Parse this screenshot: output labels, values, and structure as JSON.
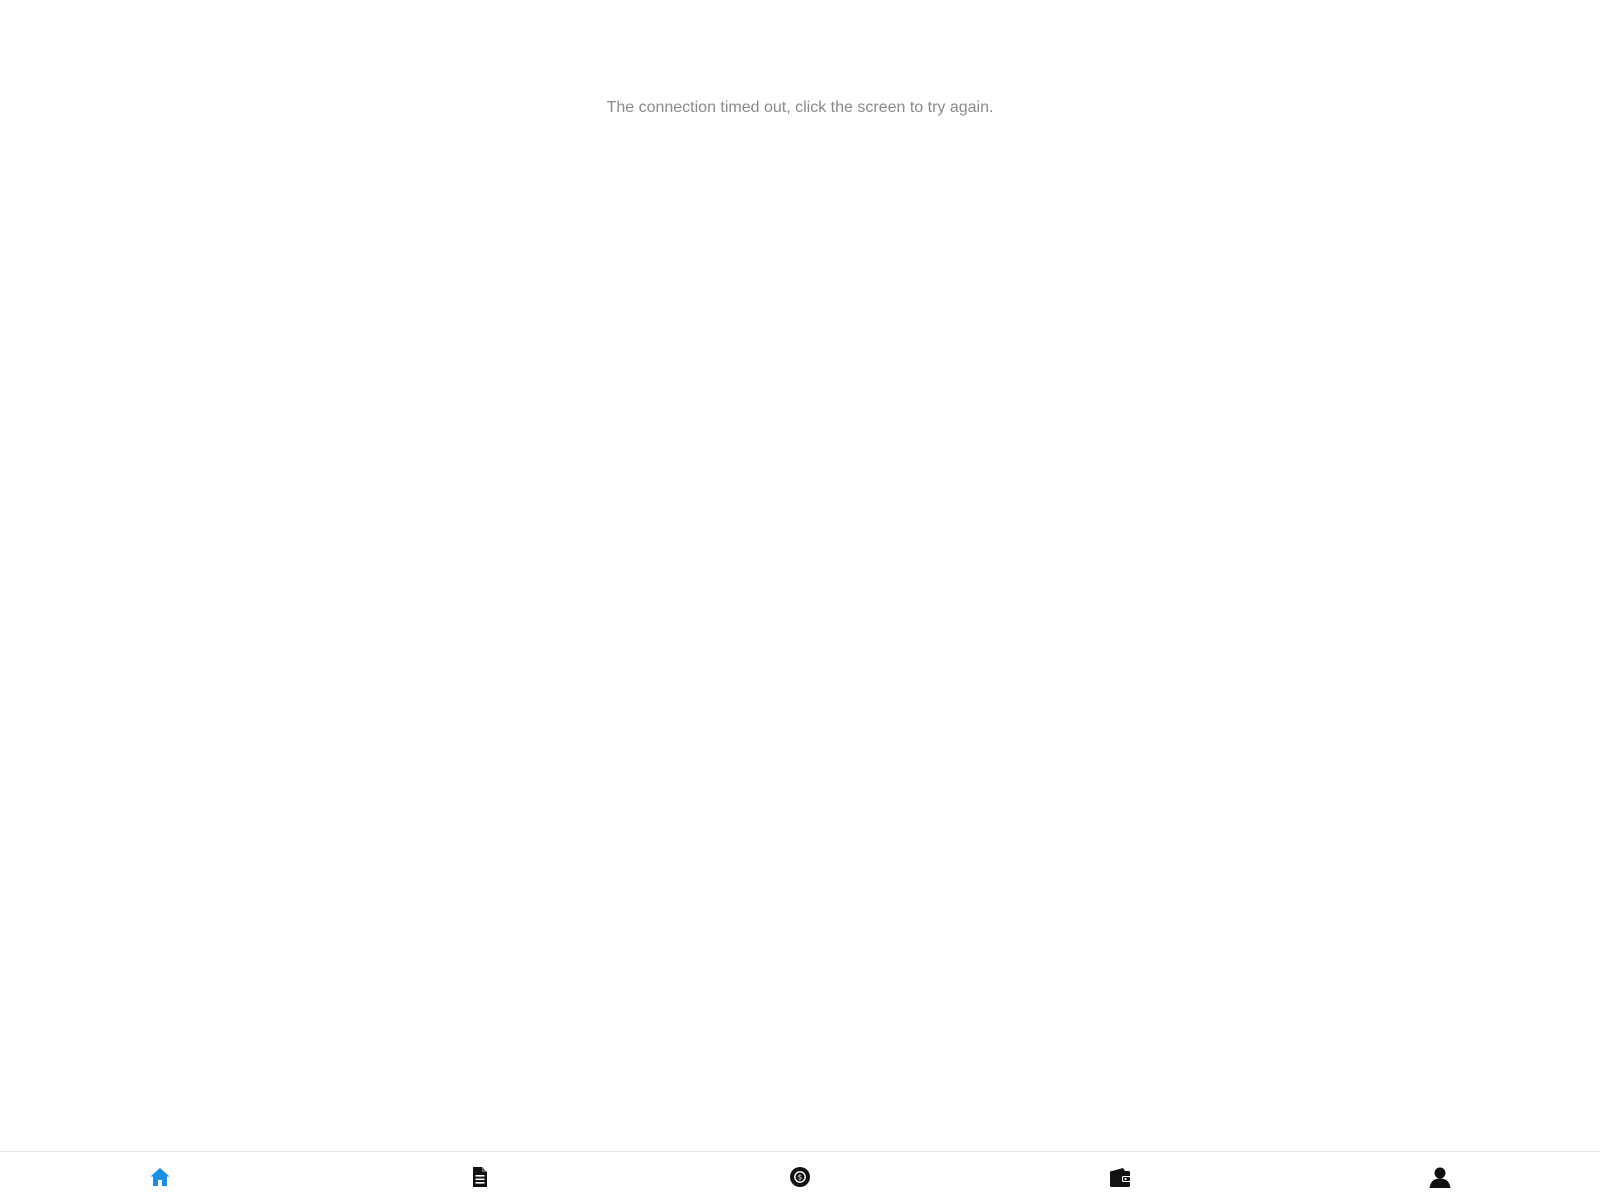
{
  "screen": {
    "message": "The connection timed out, click the screen to try again."
  },
  "tab_bar": {
    "items": [
      {
        "icon": "home-icon",
        "active": true
      },
      {
        "icon": "document-icon",
        "active": false
      },
      {
        "icon": "coin-icon",
        "active": false
      },
      {
        "icon": "wallet-icon",
        "active": false
      },
      {
        "icon": "user-icon",
        "active": false
      }
    ],
    "active_color": "#1a8fdf",
    "inactive_color": "#111111"
  }
}
